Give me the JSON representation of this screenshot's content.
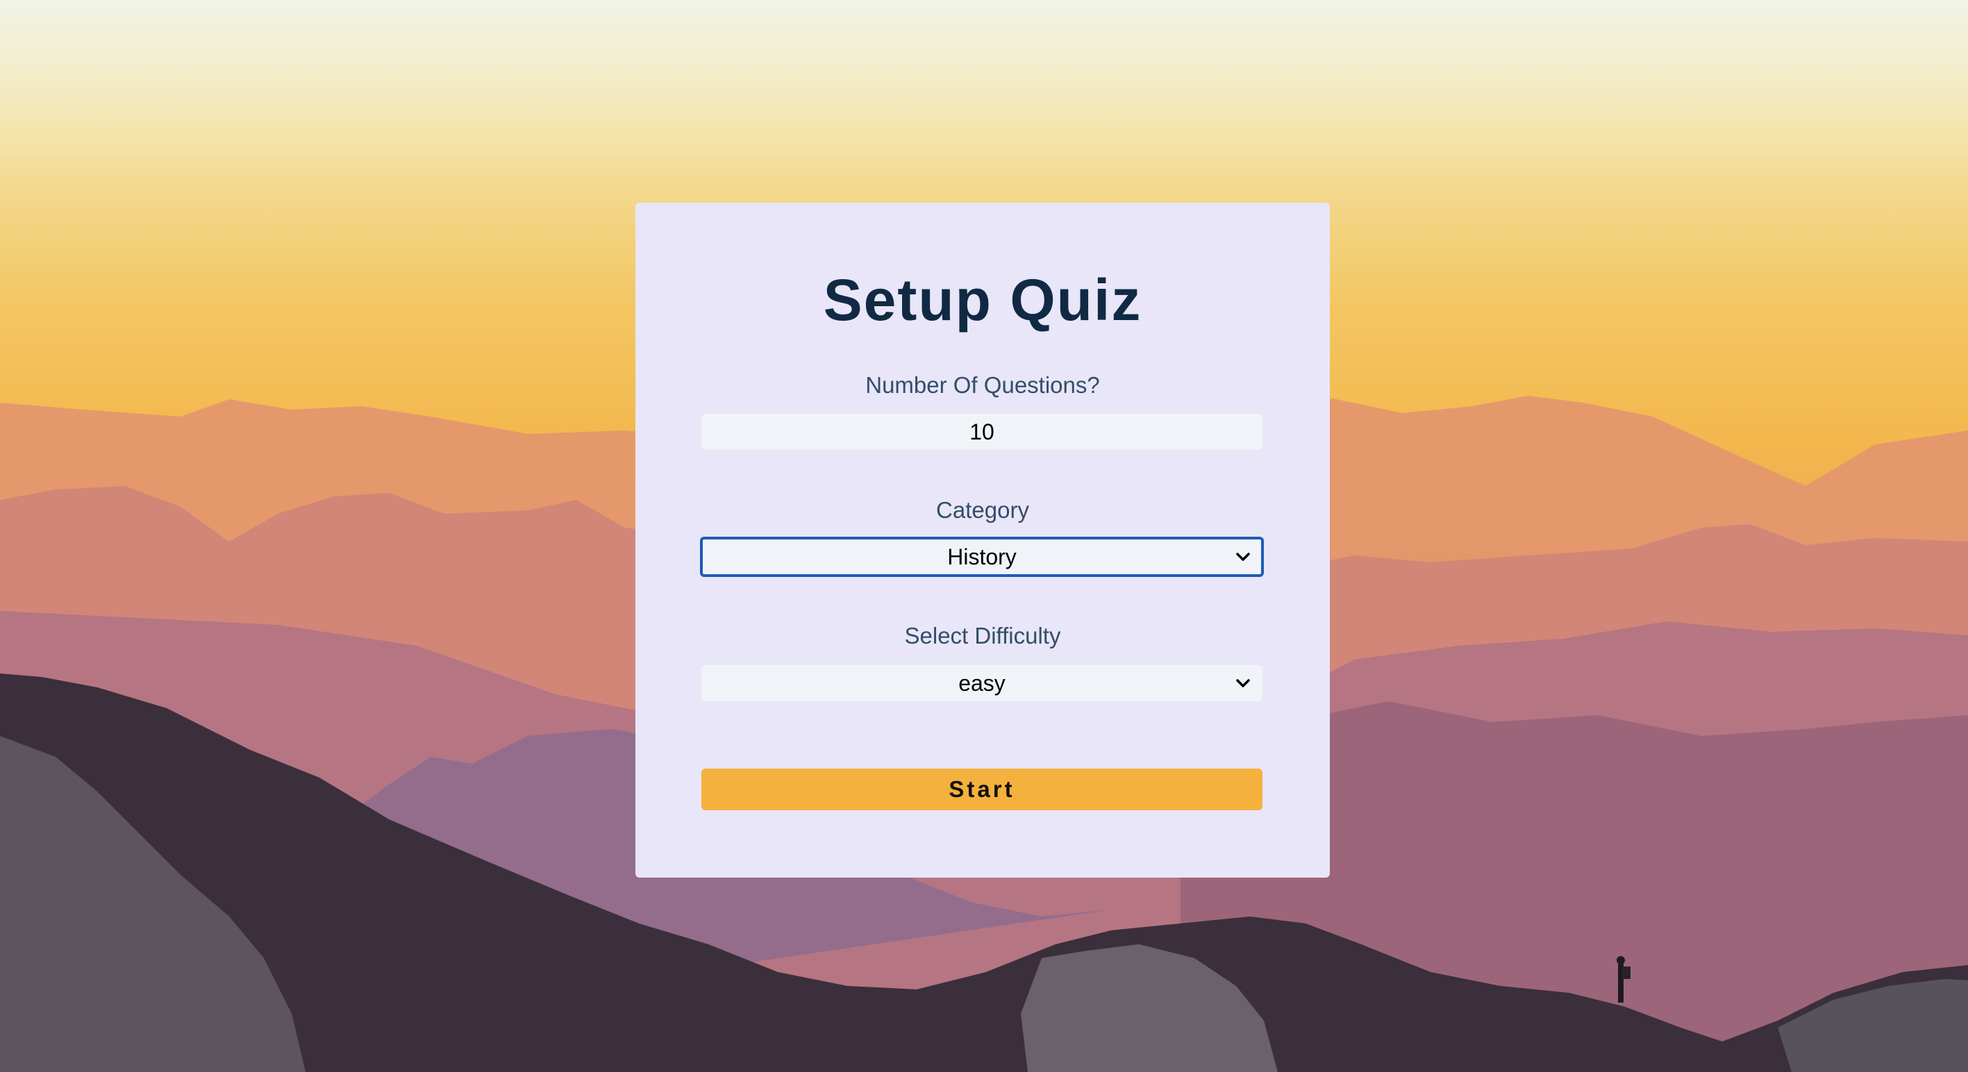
{
  "form": {
    "title": "Setup Quiz",
    "amount_label": "Number Of Questions?",
    "amount_value": "10",
    "category_label": "Category",
    "category_selected": "History",
    "difficulty_label": "Select Difficulty",
    "difficulty_selected": "easy",
    "start_label": "Start"
  },
  "icons": {
    "category_dropdown": "chevron-down-icon",
    "difficulty_dropdown": "chevron-down-icon"
  },
  "colors": {
    "card_background": "#e8e6f8",
    "title": "#102a43",
    "label": "#334e68",
    "input_background": "#f0f4f8",
    "focus_border": "#1e5bb8",
    "start_button": "#f5b13d"
  }
}
